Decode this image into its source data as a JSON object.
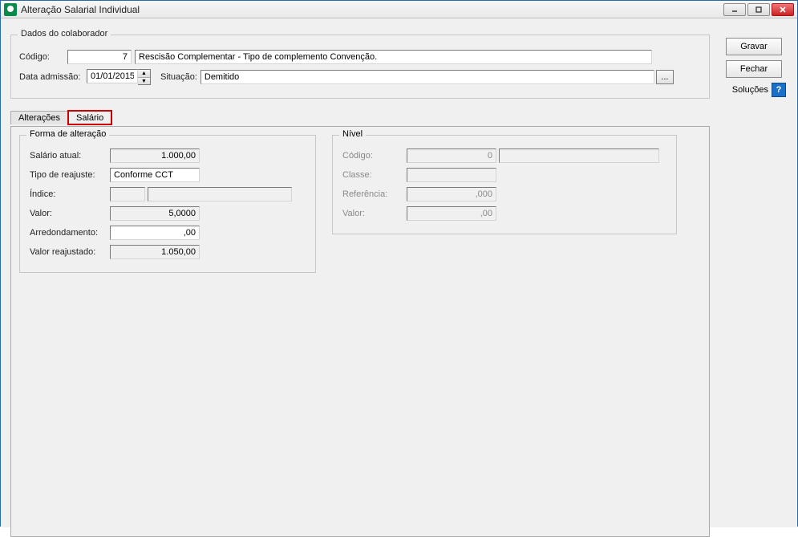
{
  "window": {
    "title": "Alteração Salarial Individual"
  },
  "buttons": {
    "gravar": "Gravar",
    "fechar": "Fechar",
    "solucoes": "Soluções"
  },
  "colab": {
    "legend": "Dados do colaborador",
    "codigo_label": "Código:",
    "codigo": "7",
    "descricao": "Rescisão Complementar - Tipo de complemento Convenção.",
    "data_admissao_label": "Data admissão:",
    "data_admissao": "01/01/2015",
    "situacao_label": "Situação:",
    "situacao": "Demitido"
  },
  "tabs": {
    "alteracoes": "Alterações",
    "salario": "Salário"
  },
  "forma": {
    "legend": "Forma de alteração",
    "salario_atual_label": "Salário atual:",
    "salario_atual": "1.000,00",
    "tipo_reajuste_label": "Tipo de reajuste:",
    "tipo_reajuste": "Conforme CCT",
    "indice_label": "Índice:",
    "indice": "",
    "indice_desc": "",
    "valor_label": "Valor:",
    "valor": "5,0000",
    "arred_label": "Arredondamento:",
    "arred": ",00",
    "valor_reaj_label": "Valor reajustado:",
    "valor_reaj": "1.050,00"
  },
  "nivel": {
    "legend": "Nível",
    "codigo_label": "Código:",
    "codigo": "0",
    "codigo_desc": "",
    "classe_label": "Classe:",
    "classe": "",
    "referencia_label": "Referência:",
    "referencia": ",000",
    "valor_label": "Valor:",
    "valor": ",00"
  }
}
